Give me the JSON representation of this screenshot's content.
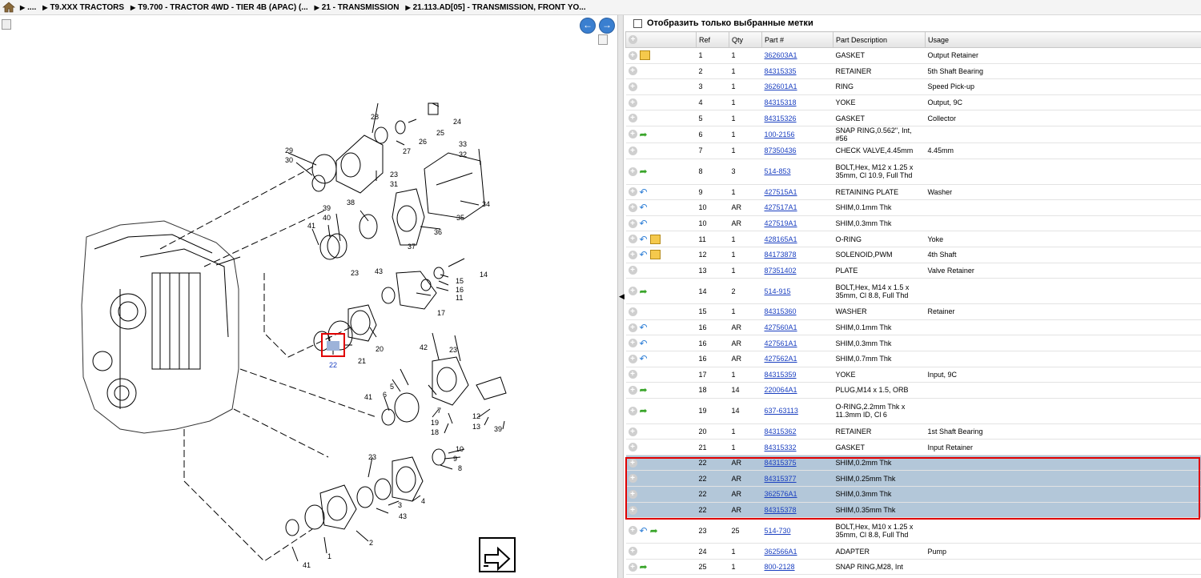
{
  "breadcrumb": [
    {
      "label": "...."
    },
    {
      "label": "T9.XXX TRACTORS"
    },
    {
      "label": "T9.700 - TRACTOR 4WD - TIER 4B (APAC) (..."
    },
    {
      "label": "21 - TRANSMISSION"
    },
    {
      "label": "21.113.AD[05] - TRANSMISSION, FRONT YO..."
    }
  ],
  "filter": {
    "label": "Отобразить только выбранные метки",
    "checked": false
  },
  "table": {
    "headers": {
      "ref": "Ref",
      "qty": "Qty",
      "part": "Part #",
      "desc": "Part Description",
      "usage": "Usage"
    },
    "rows": [
      {
        "ref": "1",
        "qty": "1",
        "part": "362603A1",
        "desc": "GASKET",
        "usage": "Output Retainer",
        "icons": [
          "box-icon"
        ]
      },
      {
        "ref": "2",
        "qty": "1",
        "part": "84315335",
        "desc": "RETAINER",
        "usage": "5th Shaft Bearing",
        "icons": []
      },
      {
        "ref": "3",
        "qty": "1",
        "part": "362601A1",
        "desc": "RING",
        "usage": "Speed Pick-up",
        "icons": []
      },
      {
        "ref": "4",
        "qty": "1",
        "part": "84315318",
        "desc": "YOKE",
        "usage": "Output, 9C",
        "icons": []
      },
      {
        "ref": "5",
        "qty": "1",
        "part": "84315326",
        "desc": "GASKET",
        "usage": "Collector",
        "icons": []
      },
      {
        "ref": "6",
        "qty": "1",
        "part": "100-2156",
        "desc": "SNAP RING,0.562\", Int, #56",
        "usage": "",
        "icons": [
          "forward-arrow-icon"
        ]
      },
      {
        "ref": "7",
        "qty": "1",
        "part": "87350436",
        "desc": "CHECK VALVE,4.45mm",
        "usage": "4.45mm",
        "icons": []
      },
      {
        "ref": "8",
        "qty": "3",
        "part": "514-853",
        "desc": "BOLT,Hex, M12 x 1.25 x 35mm, Cl 10.9, Full Thd",
        "usage": "",
        "icons": [
          "forward-arrow-icon"
        ]
      },
      {
        "ref": "9",
        "qty": "1",
        "part": "427515A1",
        "desc": "RETAINING PLATE",
        "usage": "Washer",
        "icons": [
          "back-arrow-icon"
        ]
      },
      {
        "ref": "10",
        "qty": "AR",
        "part": "427517A1",
        "desc": "SHIM,0.1mm Thk",
        "usage": "",
        "icons": [
          "back-arrow-icon"
        ]
      },
      {
        "ref": "10",
        "qty": "AR",
        "part": "427519A1",
        "desc": "SHIM,0.3mm Thk",
        "usage": "",
        "icons": [
          "back-arrow-icon"
        ]
      },
      {
        "ref": "11",
        "qty": "1",
        "part": "428165A1",
        "desc": "O-RING",
        "usage": "Yoke",
        "icons": [
          "back-arrow-icon",
          "box-icon"
        ]
      },
      {
        "ref": "12",
        "qty": "1",
        "part": "84173878",
        "desc": "SOLENOID,PWM",
        "usage": "4th Shaft",
        "icons": [
          "back-arrow-icon",
          "box-icon"
        ]
      },
      {
        "ref": "13",
        "qty": "1",
        "part": "87351402",
        "desc": "PLATE",
        "usage": "Valve Retainer",
        "icons": []
      },
      {
        "ref": "14",
        "qty": "2",
        "part": "514-915",
        "desc": "BOLT,Hex, M14 x 1.5 x 35mm, Cl 8.8, Full Thd",
        "usage": "",
        "icons": [
          "forward-arrow-icon"
        ]
      },
      {
        "ref": "15",
        "qty": "1",
        "part": "84315360",
        "desc": "WASHER",
        "usage": "Retainer",
        "icons": []
      },
      {
        "ref": "16",
        "qty": "AR",
        "part": "427560A1",
        "desc": "SHIM,0.1mm Thk",
        "usage": "",
        "icons": [
          "back-arrow-icon"
        ]
      },
      {
        "ref": "16",
        "qty": "AR",
        "part": "427561A1",
        "desc": "SHIM,0.3mm Thk",
        "usage": "",
        "icons": [
          "back-arrow-icon"
        ]
      },
      {
        "ref": "16",
        "qty": "AR",
        "part": "427562A1",
        "desc": "SHIM,0.7mm Thk",
        "usage": "",
        "icons": [
          "back-arrow-icon"
        ]
      },
      {
        "ref": "17",
        "qty": "1",
        "part": "84315359",
        "desc": "YOKE",
        "usage": "Input, 9C",
        "icons": []
      },
      {
        "ref": "18",
        "qty": "14",
        "part": "220064A1",
        "desc": "PLUG,M14 x 1.5, ORB",
        "usage": "",
        "icons": [
          "forward-arrow-icon"
        ]
      },
      {
        "ref": "19",
        "qty": "14",
        "part": "637-63113",
        "desc": "O-RING,2.2mm Thk x 11.3mm ID, Cl 6",
        "usage": "",
        "icons": [
          "forward-arrow-icon"
        ]
      },
      {
        "ref": "20",
        "qty": "1",
        "part": "84315362",
        "desc": "RETAINER",
        "usage": "1st Shaft Bearing",
        "icons": []
      },
      {
        "ref": "21",
        "qty": "1",
        "part": "84315332",
        "desc": "GASKET",
        "usage": "Input Retainer",
        "icons": []
      },
      {
        "ref": "22",
        "qty": "AR",
        "part": "84315375",
        "desc": "SHIM,0.2mm Thk",
        "usage": "",
        "icons": [],
        "selected": true
      },
      {
        "ref": "22",
        "qty": "AR",
        "part": "84315377",
        "desc": "SHIM,0.25mm Thk",
        "usage": "",
        "icons": [],
        "selected": true
      },
      {
        "ref": "22",
        "qty": "AR",
        "part": "362576A1",
        "desc": "SHIM,0.3mm Thk",
        "usage": "",
        "icons": [],
        "selected": true
      },
      {
        "ref": "22",
        "qty": "AR",
        "part": "84315378",
        "desc": "SHIM,0.35mm Thk",
        "usage": "",
        "icons": [],
        "selected": true
      },
      {
        "ref": "23",
        "qty": "25",
        "part": "514-730",
        "desc": "BOLT,Hex, M10 x 1.25 x 35mm, Cl 8.8, Full Thd",
        "usage": "",
        "icons": [
          "back-arrow-icon",
          "forward-arrow-icon"
        ]
      },
      {
        "ref": "24",
        "qty": "1",
        "part": "362566A1",
        "desc": "ADAPTER",
        "usage": "Pump",
        "icons": []
      },
      {
        "ref": "25",
        "qty": "1",
        "part": "800-2128",
        "desc": "SNAP RING,M28, Int",
        "usage": "",
        "icons": [
          "forward-arrow-icon"
        ]
      }
    ]
  },
  "diagram": {
    "callouts": [
      "28",
      "24",
      "26",
      "25",
      "27",
      "29",
      "30",
      "23",
      "31",
      "33",
      "32",
      "34",
      "35",
      "36",
      "37",
      "38",
      "39",
      "40",
      "41",
      "23",
      "43",
      "14",
      "15",
      "16",
      "11",
      "17",
      "20",
      "21",
      "22",
      "42",
      "23",
      "5",
      "6",
      "7",
      "12",
      "13",
      "39",
      "41",
      "19",
      "18",
      "10",
      "9",
      "8",
      "23",
      "4",
      "3",
      "43",
      "2",
      "1",
      "41"
    ],
    "highlighted_callout": "22"
  }
}
